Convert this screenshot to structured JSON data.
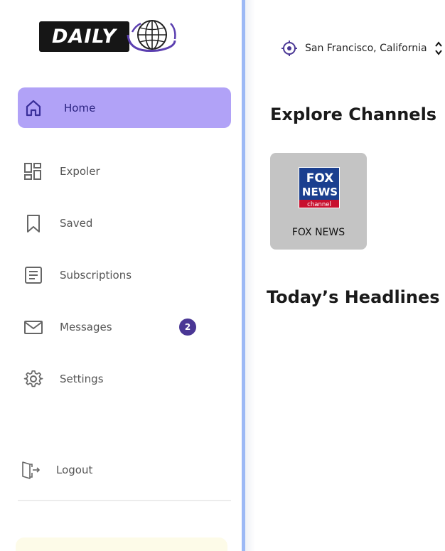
{
  "brand": {
    "logo_text": "DAILY"
  },
  "sidebar": {
    "items": [
      {
        "label": "Home",
        "icon": "home-icon",
        "active": true
      },
      {
        "label": "Expoler",
        "icon": "explore-grid-icon"
      },
      {
        "label": "Saved",
        "icon": "bookmark-icon"
      },
      {
        "label": "Subscriptions",
        "icon": "subscriptions-icon"
      },
      {
        "label": "Messages",
        "icon": "mail-icon",
        "badge": "2"
      },
      {
        "label": "Settings",
        "icon": "gear-icon"
      }
    ],
    "logout_label": "Logout"
  },
  "header": {
    "location": "San Francisco, California",
    "location_icon": "location-target-icon",
    "chevron_icon": "chevron-up-down-icon"
  },
  "main": {
    "explore_title": "Explore Channels",
    "channels": [
      {
        "name": "FOX NEWS",
        "logo_line1": "FOX",
        "logo_line2": "NEWS",
        "logo_line3": "channel"
      }
    ],
    "headlines_title": "Today’s Headlines"
  },
  "colors": {
    "accent": "#b1a2f7",
    "active_text": "#2b2380",
    "badge": "#4a3795",
    "divider": "#9cb9f5",
    "card_bg": "#c4c4c4"
  }
}
